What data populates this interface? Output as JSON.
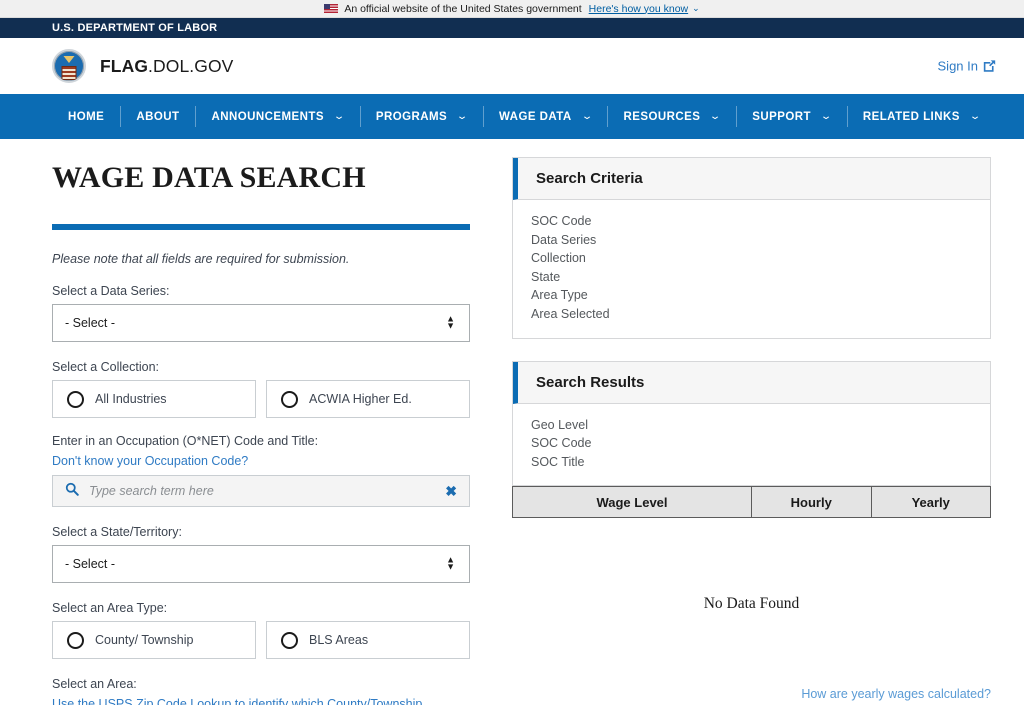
{
  "usa_banner": {
    "flag_icon": "us-flag-icon",
    "text": "An official website of the United States government",
    "how_you_know": "Here's how you know",
    "caret_icon": "chevron-down-icon"
  },
  "dol_bar": {
    "agency": "U.S. DEPARTMENT OF LABOR"
  },
  "brand": {
    "seal_icon": "dol-seal-icon",
    "name_bold": "FLAG",
    "name_rest": ".DOL.GOV",
    "sign_in_label": "Sign In",
    "sign_in_icon": "external-link-icon"
  },
  "nav": {
    "items": [
      {
        "label": "HOME",
        "has_caret": false
      },
      {
        "label": "ABOUT",
        "has_caret": false
      },
      {
        "label": "ANNOUNCEMENTS",
        "has_caret": true
      },
      {
        "label": "PROGRAMS",
        "has_caret": true
      },
      {
        "label": "WAGE DATA",
        "has_caret": true
      },
      {
        "label": "RESOURCES",
        "has_caret": true
      },
      {
        "label": "SUPPORT",
        "has_caret": true
      },
      {
        "label": "RELATED LINKS",
        "has_caret": true
      }
    ],
    "caret_glyph": "⌄"
  },
  "form": {
    "page_title": "WAGE DATA SEARCH",
    "note": "Please note that all fields are required for submission.",
    "data_series": {
      "label": "Select a Data Series:",
      "value": "- Select -"
    },
    "collection": {
      "label": "Select a Collection:",
      "options": [
        {
          "label": "All Industries",
          "selected": false
        },
        {
          "label": "ACWIA Higher Ed.",
          "selected": false
        }
      ]
    },
    "occupation": {
      "label": "Enter in an Occupation (O*NET) Code and Title:",
      "help_link": "Don't know your Occupation Code?",
      "search_icon": "search-icon",
      "placeholder": "Type search term here",
      "value": "",
      "clear_icon": "clear-x-icon",
      "clear_glyph": "✖"
    },
    "state": {
      "label": "Select a State/Territory:",
      "value": "- Select -"
    },
    "area_type": {
      "label": "Select an Area Type:",
      "options": [
        {
          "label": "County/ Township",
          "selected": false
        },
        {
          "label": "BLS Areas",
          "selected": false
        }
      ]
    },
    "area": {
      "label": "Select an Area:",
      "help_link": "Use the USPS Zip Code Lookup to identify which County/Township"
    }
  },
  "search_criteria": {
    "title": "Search Criteria",
    "items": [
      "SOC Code",
      "Data Series",
      "Collection",
      "State",
      "Area Type",
      "Area Selected"
    ]
  },
  "search_results": {
    "title": "Search Results",
    "items": [
      "Geo Level",
      "SOC Code",
      "SOC Title"
    ],
    "table_headers": [
      "Wage Level",
      "Hourly",
      "Yearly"
    ],
    "empty_message": "No Data Found",
    "footer_link": "How are yearly wages calculated?"
  },
  "colors": {
    "nav_blue": "#0b6cb4",
    "dol_navy": "#112e51",
    "link_blue": "#2f7bc4",
    "accent_blue": "#0b6cb4"
  }
}
